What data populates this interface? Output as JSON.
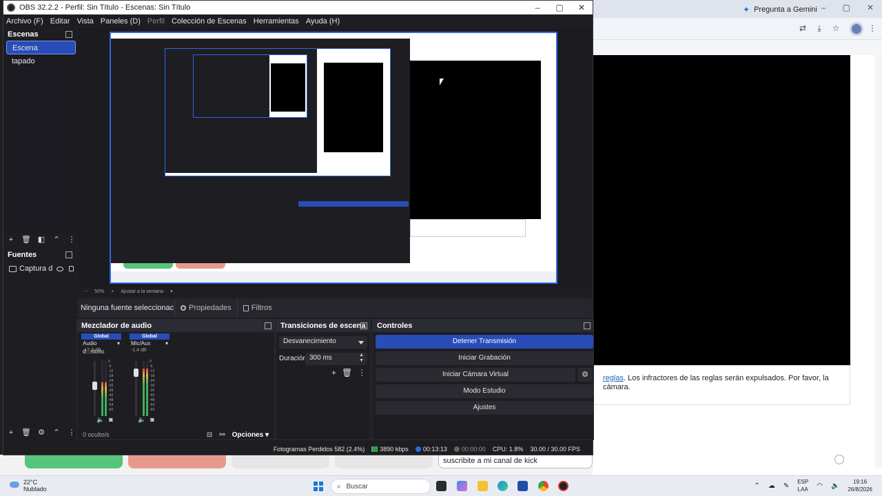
{
  "obs": {
    "title": "OBS 32.2.2 - Perfil: Sin Título - Escenas: Sin Título",
    "menu": [
      "Archivo (F)",
      "Editar",
      "Vista",
      "Paneles (D)",
      "Perfil",
      "Colección de Escenas",
      "Herramientas",
      "Ayuda (H)"
    ],
    "scenes": {
      "title": "Escenas",
      "items": [
        "Escena",
        "tapado"
      ]
    },
    "sources": {
      "title": "Fuentes",
      "items": [
        "Captura d"
      ]
    },
    "zoom": "50%",
    "zoom_fit": "Ajustar a la ventana",
    "no_source": "Ninguna fuente seleccionac",
    "properties_label": "Propiedades",
    "filters_label": "Filtros",
    "mixer": {
      "title": "Mezclador de audio",
      "channels": [
        {
          "tag": "Global",
          "name": "Audio d...ritorio",
          "db": "-12.3 dB",
          "level": 0.62
        },
        {
          "tag": "Global",
          "name": "Mic/Aux",
          "db": "-1.4 dB",
          "level": 0.86
        }
      ],
      "scale": [
        "0",
        "-6",
        "-12",
        "-18",
        "-24",
        "-30",
        "-36",
        "-42",
        "-48",
        "-54",
        "-60"
      ],
      "hidden": "0 oculto/s",
      "options": "Opciones"
    },
    "transitions": {
      "title": "Transiciones de escena",
      "selected": "Desvanecimiento",
      "duration_label": "Duración",
      "duration_value": "300 ms"
    },
    "controls": {
      "title": "Controles",
      "buttons": [
        "Detener Transmisión",
        "Iniciar Grabación",
        "Iniciar Cámara Virtual",
        "Modo Estudio",
        "Ajustes"
      ]
    },
    "status": {
      "dropped": "Fotogramas Perdidos 582 (2.4%)",
      "bitrate": "3890 kbps",
      "stream_time": "00:13:13",
      "rec_time": "00:00:00",
      "cpu": "CPU: 1.8%",
      "fps": "30.00 / 30.00 FPS"
    }
  },
  "browser": {
    "tab": "Pregunta a Gemini",
    "text_link": "reglas",
    "text_rest": ". Los infractores de las reglas serán expulsados. Por favor, la cámara."
  },
  "chat": {
    "input": "suscribite a mi canal de kick"
  },
  "taskbar": {
    "temp": "22°C",
    "weather": "Nublado",
    "search": "Buscar",
    "lang1": "ESP",
    "lang2": "LAA",
    "time": "19:16",
    "date": "26/8/2026"
  },
  "colors": {
    "accent": "#284cb8",
    "obs_bg": "#1d1d22",
    "signal": "#3fae5a",
    "green_pill": "#56c47a",
    "red_pill": "#e79a8c"
  }
}
